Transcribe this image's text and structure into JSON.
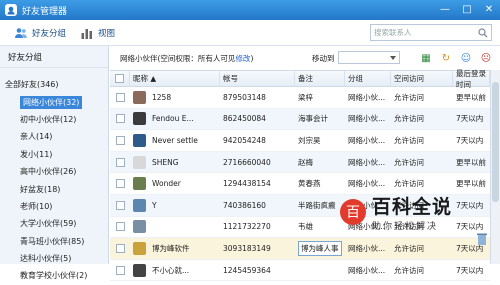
{
  "window": {
    "title": "好友管理器"
  },
  "toolbar": {
    "friends_group": "好友分组",
    "view": "视图",
    "search_placeholder": "搜索联系人"
  },
  "sidebar": {
    "title": "好友分组",
    "items": [
      {
        "label": "全部好友(346)",
        "root": true
      },
      {
        "label": "网络小伙伴(32)",
        "selected": true
      },
      {
        "label": "初中小伙伴(12)"
      },
      {
        "label": "亲人(14)"
      },
      {
        "label": "发小(11)"
      },
      {
        "label": "高中小伙伴(26)"
      },
      {
        "label": "好盆友(18)"
      },
      {
        "label": "老师(10)"
      },
      {
        "label": "大学小伙伴(59)"
      },
      {
        "label": "青马班小伙伴(85)"
      },
      {
        "label": "达科小伙伴(5)"
      },
      {
        "label": "教育学校小伙伴(2)"
      }
    ]
  },
  "info": {
    "group_text": "网络小伙伴(空间权限：所有人可见",
    "edit": "修改",
    "close_paren": ")",
    "move_to": "移动到"
  },
  "table": {
    "headers": [
      "昵称 ▲",
      "帐号",
      "备注",
      "分组",
      "空间访问",
      "最后登录时间"
    ],
    "rows": [
      {
        "nick": "1258",
        "acct": "879503148",
        "remark": "梁梓",
        "group": "网络小伙...",
        "space": "允许访问",
        "last": "更早以前",
        "ava": "#8a6a5a"
      },
      {
        "nick": "Fendou E...",
        "acct": "862450084",
        "remark": "海事会计",
        "group": "网络小伙...",
        "space": "允许访问",
        "last": "7天以内",
        "ava": "#3b3b3b"
      },
      {
        "nick": "Never settle",
        "acct": "942054248",
        "remark": "刘宗昊",
        "group": "网络小伙...",
        "space": "允许访问",
        "last": "7天以内",
        "ava": "#2f5b8a"
      },
      {
        "nick": "SHENG",
        "acct": "2716660040",
        "remark": "赵梅",
        "group": "网络小伙...",
        "space": "允许访问",
        "last": "更早以前",
        "ava": "#d8d8d8"
      },
      {
        "nick": "Wonder",
        "acct": "1294438154",
        "remark": "黄春燕",
        "group": "网络小伙...",
        "space": "允许访问",
        "last": "更早以前",
        "ava": "#6a7d4f"
      },
      {
        "nick": "Y",
        "acct": "740386160",
        "remark": "半路街疯癫",
        "group": "网络小伙...",
        "space": "允许访问",
        "last": "7天以内",
        "ava": "#5b86b0"
      },
      {
        "nick": "",
        "acct": "1121732270",
        "remark": "韦雄",
        "group": "网络小伙...",
        "space": "允许访问",
        "last": "7天以内",
        "ava": "#7a8fa4"
      },
      {
        "nick": "博为峰软件",
        "acct": "3093183149",
        "remark": "博为峰人事",
        "group": "网络小伙...",
        "space": "允许访问",
        "last": "7天以内",
        "ava": "#c9a23b"
      },
      {
        "nick": "不小心就...",
        "acct": "1245459364",
        "remark": "",
        "group": "网络小伙...",
        "space": "允许访问",
        "last": "7天以内",
        "ava": "#444444"
      }
    ]
  },
  "watermark": {
    "badge": "百",
    "title": "百科全说",
    "sub": "助你轻松解决"
  }
}
